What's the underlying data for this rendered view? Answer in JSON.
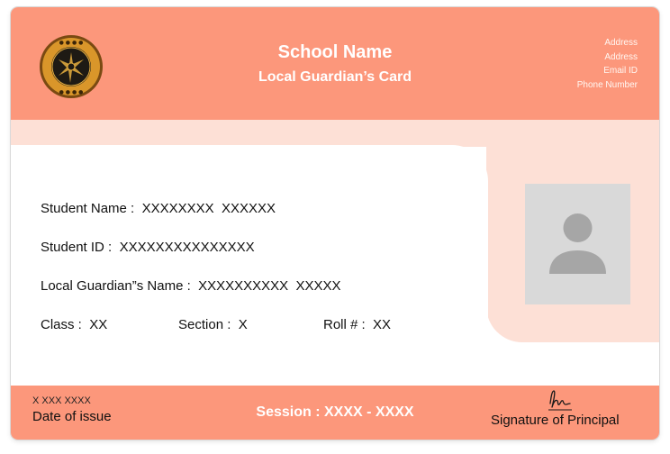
{
  "header": {
    "school_name": "School Name",
    "card_type": "Local Guardian’s Card",
    "logo_icon": "school-crest-icon",
    "contact": {
      "address1": "Address",
      "address2": "Address",
      "email": "Email ID",
      "phone": "Phone Number"
    }
  },
  "photo": {
    "icon": "user-avatar-placeholder-icon"
  },
  "fields": {
    "student_name": {
      "label": "Student Name :",
      "value": "XXXXXXXX  XXXXXX"
    },
    "student_id": {
      "label": "Student ID :",
      "value": "XXXXXXXXXXXXXXX"
    },
    "guardian_name": {
      "label": "Local Guardian”s Name :",
      "value": "XXXXXXXXXX  XXXXX"
    },
    "class": {
      "label": "Class :",
      "value": "XX"
    },
    "section": {
      "label": "Section :",
      "value": "X"
    },
    "roll": {
      "label": "Roll # :",
      "value": "XX"
    }
  },
  "footer": {
    "issue_date": "X XXX XXXX",
    "issue_label": "Date of issue",
    "session_label": "Session :",
    "session_value": "XXXX - XXXX",
    "signature_icon": "signature-icon",
    "signature_label": "Signature of Principal"
  },
  "colors": {
    "accent": "#fc977b",
    "accent_light": "#fde0d6",
    "photo_bg": "#d9d9d9",
    "avatar": "#a6a6a6"
  }
}
